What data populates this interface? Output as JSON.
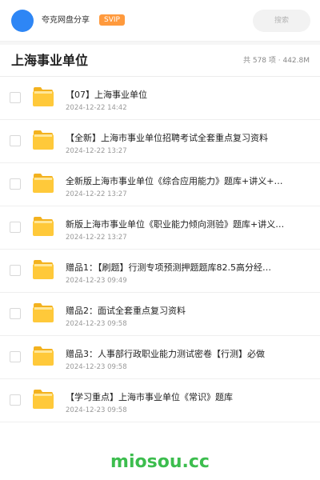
{
  "header": {
    "share_name": "夸克网盘分享",
    "badge": "SVIP",
    "search_placeholder": "搜索"
  },
  "folder_title": "上海事业单位",
  "meta": "共 578 项 · 442.8M",
  "files": [
    {
      "name": "【07】上海事业单位",
      "date": "2024-12-22 14:42"
    },
    {
      "name": "【全新】上海市事业单位招聘考试全套重点复习资料",
      "date": "2024-12-22 13:27"
    },
    {
      "name": "全新版上海市事业单位《综合应用能力》题库+讲义+重…",
      "date": "2024-12-22 13:27"
    },
    {
      "name": "新版上海市事业单位《职业能力倾向测验》题库+讲义+…",
      "date": "2024-12-22 13:27"
    },
    {
      "name": "赠品1：【刷题】行测专项预测押题题库82.5高分经…",
      "date": "2024-12-23 09:49"
    },
    {
      "name": "赠品2：面试全套重点复习资料",
      "date": "2024-12-23 09:58"
    },
    {
      "name": "赠品3：人事部行政职业能力测试密卷【行测】必做",
      "date": "2024-12-23 09:58"
    },
    {
      "name": "【学习重点】上海市事业单位《常识》题库",
      "date": "2024-12-23 09:58"
    }
  ],
  "watermark": "miosou.cc",
  "colors": {
    "avatar": "#2e86f5",
    "svip_badge": "#ff9a3d",
    "folder": "#ffc93a",
    "watermark": "#3cbd4e"
  }
}
